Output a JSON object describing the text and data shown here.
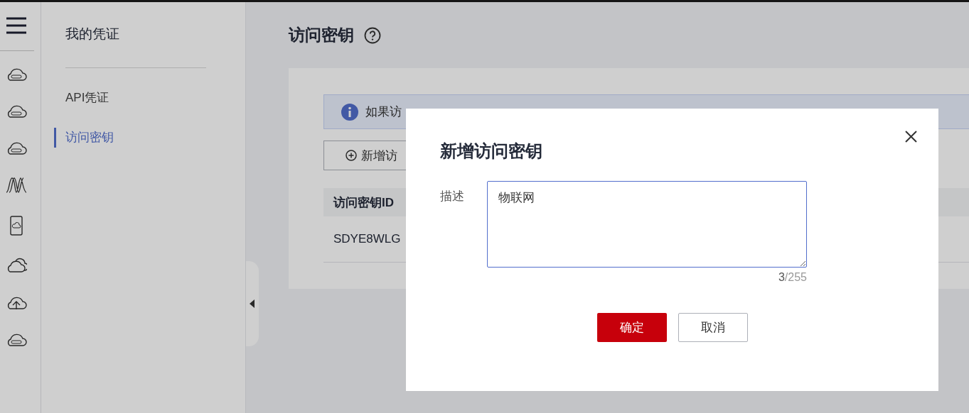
{
  "sidebar": {
    "title": "我的凭证",
    "items": [
      {
        "label": "API凭证",
        "selected": false
      },
      {
        "label": "访问密钥",
        "selected": true
      }
    ]
  },
  "page": {
    "title": "访问密钥"
  },
  "banner": {
    "text": "如果访"
  },
  "add_button": {
    "label": "新增访"
  },
  "table": {
    "columns": [
      "访问密钥ID"
    ],
    "rows": [
      [
        "SDYE8WLG"
      ]
    ]
  },
  "dialog": {
    "title": "新增访问密钥",
    "field": {
      "label": "描述",
      "value": "物联网"
    },
    "counter": {
      "count": "3",
      "max": "/255"
    },
    "buttons": [
      {
        "label": "确定",
        "kind": "primary"
      },
      {
        "label": "取消",
        "kind": "secondary"
      }
    ]
  }
}
